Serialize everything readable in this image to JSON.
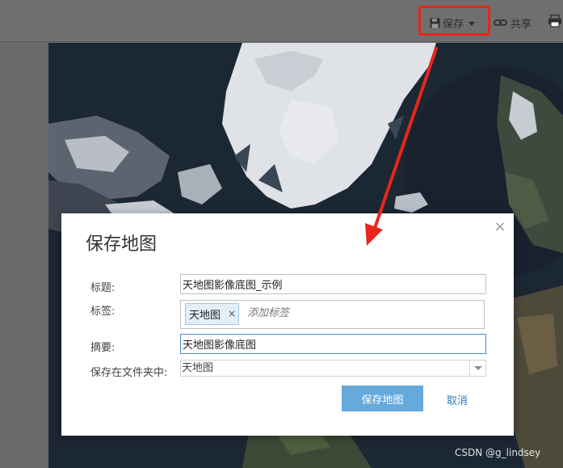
{
  "toolbar": {
    "save_label": "保存",
    "share_label": "共享",
    "save_icon": "floppy-disk-icon",
    "share_icon": "link-icon",
    "print_icon": "printer-icon"
  },
  "dialog": {
    "title": "保存地图",
    "close_glyph": "×",
    "fields": {
      "title_label": "标题:",
      "title_value": "天地图影像底图_示例",
      "tags_label": "标签:",
      "tag_item": "天地图",
      "tag_remove": "×",
      "tags_placeholder": "添加标签",
      "summary_label": "摘要:",
      "summary_value": "天地图影像底图",
      "folder_label": "保存在文件夹中:",
      "folder_value": "天地图"
    },
    "save_button": "保存地图",
    "cancel_button": "取消"
  },
  "annotation": {
    "highlight_color": "#e8261c"
  },
  "watermark": "CSDN @g_lindsey",
  "colors": {
    "primary_button": "#65a9dd",
    "link": "#2d7cc1",
    "focus_border": "#4b8bd0"
  }
}
